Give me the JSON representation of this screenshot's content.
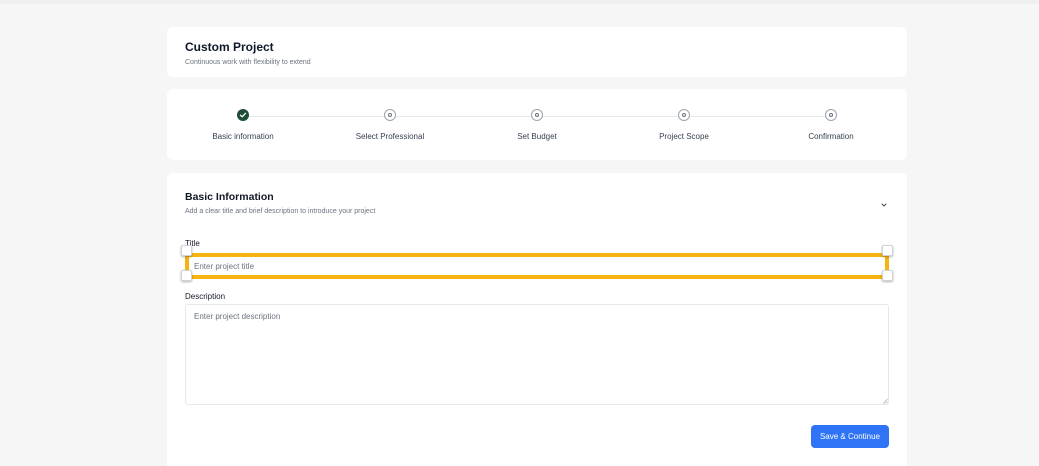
{
  "header": {
    "title": "Custom Project",
    "subtitle": "Continuous work with flexibility to extend"
  },
  "stepper": {
    "steps": [
      {
        "label": "Basic information",
        "status": "done"
      },
      {
        "label": "Select Professional",
        "status": "pending"
      },
      {
        "label": "Set Budget",
        "status": "pending"
      },
      {
        "label": "Project Scope",
        "status": "pending"
      },
      {
        "label": "Confirmation",
        "status": "pending"
      }
    ]
  },
  "form": {
    "section_title": "Basic Information",
    "section_subtitle": "Add a clear title and brief description to introduce your project",
    "title_label": "Title",
    "title_placeholder": "Enter project title",
    "title_value": "",
    "description_label": "Description",
    "description_placeholder": "Enter project description",
    "description_value": "",
    "save_label": "Save & Continue"
  },
  "colors": {
    "accent": "#2f74f6",
    "done_step": "#1f4d3a",
    "selection_highlight": "#f5b40f"
  },
  "icons": {
    "done_step": "check-icon",
    "pending_step": "circle-dot-icon",
    "collapse": "chevron-down-icon"
  }
}
